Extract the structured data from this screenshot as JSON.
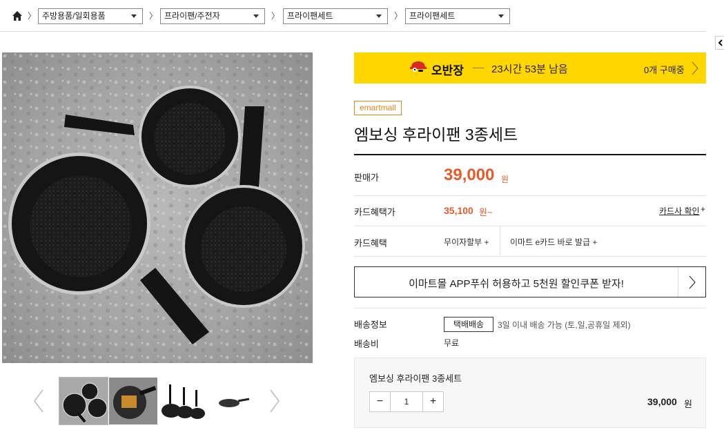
{
  "breadcrumb": {
    "home_icon": "home-icon",
    "levels": [
      "주방용품/일회용품",
      "프라이팬/주전자",
      "프라이팬세트",
      "프라이팬세트"
    ]
  },
  "oban": {
    "brand": "오반장",
    "time_left": "23시간 53분 남음",
    "purchase_count": "0개 구매중"
  },
  "product": {
    "mall": "emartmall",
    "title": "엠보싱 후라이팬 3종세트"
  },
  "price": {
    "label": "판매가",
    "value": "39,000",
    "unit": "원"
  },
  "card_price": {
    "label": "카드혜택가",
    "value": "35,100",
    "unit": "원~",
    "confirm": "카드사 확인",
    "plus": "+"
  },
  "card_benefit": {
    "label": "카드혜택",
    "installment": "무이자할부 +",
    "emart_card": "이마트 e카드 바로 발급 +"
  },
  "app_banner": {
    "text": "이마트몰 APP푸쉬 허용하고 5천원 할인쿠폰 받자!"
  },
  "shipping": {
    "label": "배송정보",
    "method": "택배배송",
    "info": "3일 이내 배송 가능 (토,일,공휴일 제외)",
    "fee_label": "배송비",
    "fee": "무료"
  },
  "option": {
    "name": "엠보싱 후라이팬 3종세트",
    "minus": "−",
    "quantity": "1",
    "plus": "+",
    "price": "39,000",
    "unit": "원"
  },
  "colors": {
    "oban_yellow": "#ffd600",
    "price_orange": "#e85a2a",
    "badge_orange": "#e8831f"
  }
}
